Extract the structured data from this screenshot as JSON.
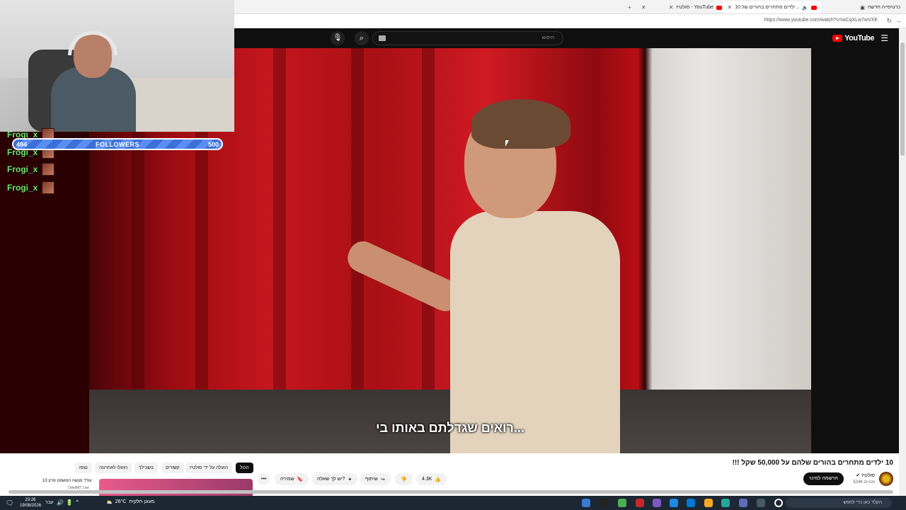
{
  "browser": {
    "tabs": [
      {
        "label": "כרטיסייה חדשה"
      },
      {
        "label": "10 ילדים מתחרים בהורים של..."
      },
      {
        "label": "סולטיז - YouTube"
      }
    ],
    "url": "https://www.youtube.com/watch?v=wCqXLw7wVXE"
  },
  "youtube": {
    "logo_text": "YouTube",
    "search_placeholder": "חיפוש"
  },
  "video": {
    "subtitle": "רואים שגדלתם באותו בי..."
  },
  "overlay": {
    "followers_current": "494",
    "followers_label": "FOLLOWERS",
    "followers_goal": "500",
    "followers_progress": 0.988,
    "chat": [
      {
        "name": "Frogi_x"
      },
      {
        "name": "Frogi_x"
      },
      {
        "name": "Frogi_x"
      },
      {
        "name": "Frogi_x"
      }
    ]
  },
  "details": {
    "title": "10 ילדים מתחרים בהורים שלהם על 50,000 שקל !!!",
    "channel_name": "סולטיז",
    "channel_subs": "524K מנויים",
    "subscribe_label": "הרשמה למינוי",
    "like_count": "4.3K",
    "share_label": "שיתוף",
    "ask_label": "יש לך שאלה?",
    "save_label": "שמירה",
    "chips": [
      "הכול",
      "הועלה על ידי סולטיז",
      "קשורים",
      "בשבילך",
      "הועלו לאחרונה",
      "נצפו"
    ],
    "rec_title": "עודד מנשה המשפט פרק 13",
    "rec_meta": "OdedMT Live"
  },
  "taskbar": {
    "search_placeholder": "הקלד כאן כדי לחפש",
    "weather": "26°C",
    "weather_desc": "מעונן חלקית",
    "time": "23:26",
    "date": "19/08/2026",
    "lang": "עבר"
  }
}
